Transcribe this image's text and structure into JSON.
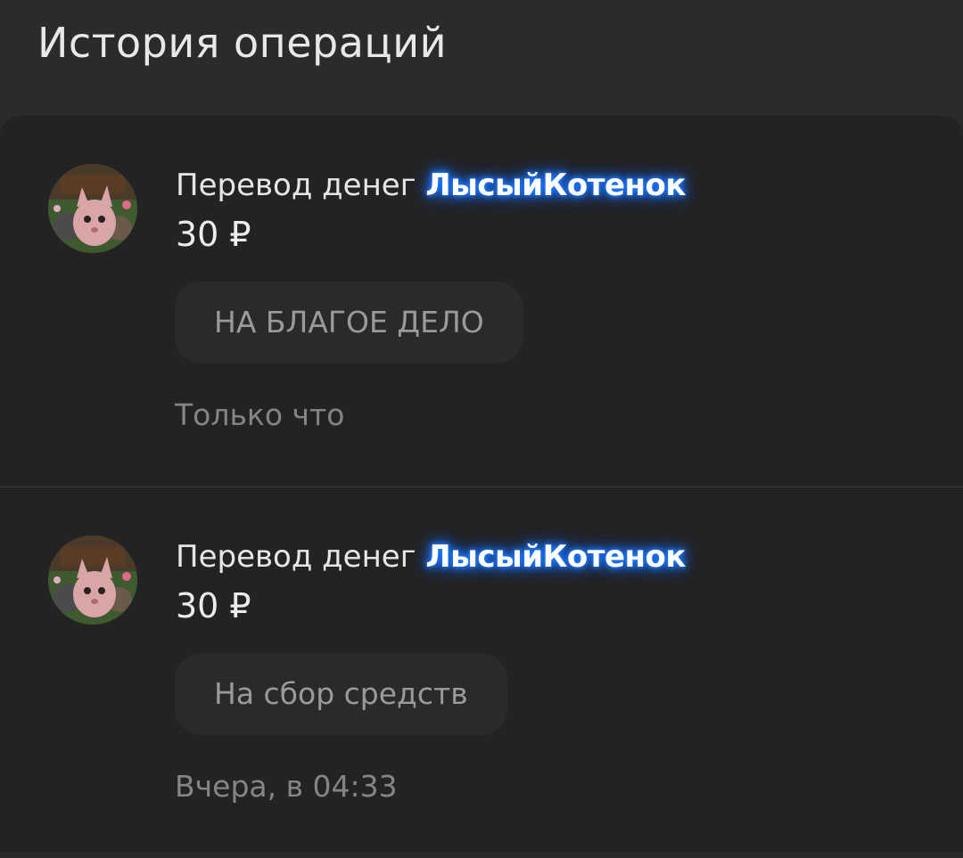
{
  "header": {
    "title": "История операций"
  },
  "operations": [
    {
      "prefix": "Перевод денег",
      "username": "ЛысыйКотенок",
      "amount": "30 ₽",
      "comment": "НА БЛАГОЕ ДЕЛО",
      "time": "Только что",
      "avatar_icon": "cat-avatar-icon"
    },
    {
      "prefix": "Перевод денег",
      "username": "ЛысыйКотенок",
      "amount": "30 ₽",
      "comment": "На сбор средств",
      "time": "Вчера, в 04:33",
      "avatar_icon": "cat-avatar-icon"
    }
  ],
  "colors": {
    "background": "#2b2b2c",
    "card": "#232324",
    "username_glow": "#1e7bff"
  }
}
